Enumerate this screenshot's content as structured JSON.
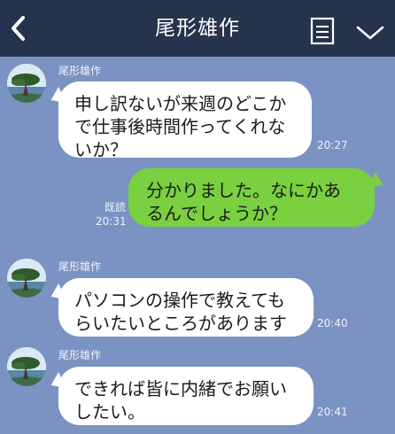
{
  "header": {
    "title": "尾形雄作",
    "back_icon": "chevron-left-icon",
    "menu_icon": "memo-list-icon",
    "collapse_icon": "chevron-down-icon",
    "background": "#26334d"
  },
  "chat": {
    "background": "#7b93c2",
    "messages": [
      {
        "sender": "尾形雄作",
        "text": "申し訳ないが来週のどこかで仕事後時間作ってくれないか？",
        "time": "20:27"
      },
      {
        "text": "分かりました。なにかあるんでしょうか？",
        "read": "既読",
        "time": "20:31"
      },
      {
        "sender": "尾形雄作",
        "text": "パソコンの操作で教えてもらいたいところがあります",
        "time": "20:40"
      },
      {
        "sender": "尾形雄作",
        "text": "できれば皆に内緒でお願いしたい。",
        "time": "20:41"
      }
    ]
  }
}
